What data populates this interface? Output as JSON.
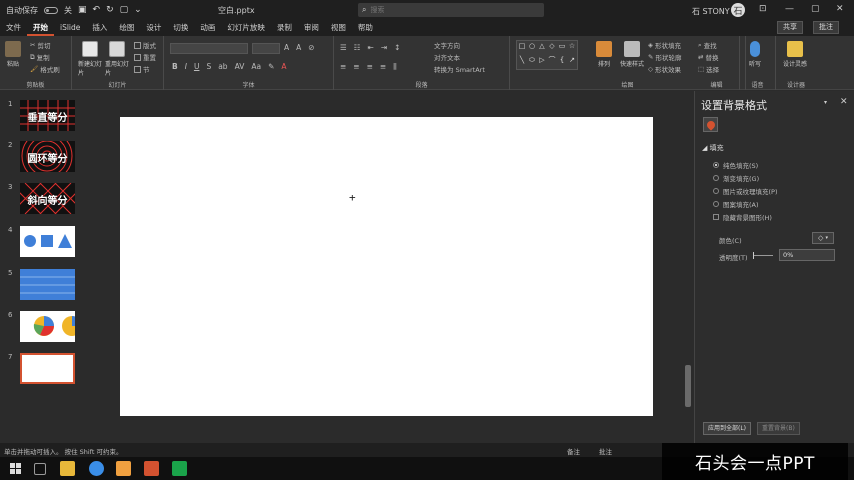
{
  "window": {
    "autosave_label": "自动保存",
    "autosave_state": "关",
    "doc_title": "空白.pptx",
    "search_placeholder": "搜索",
    "user_name": "石 STONY",
    "avatar_letter": "石",
    "ribbon_display_icon": "⊡",
    "minimize": "—",
    "maximize": "▢",
    "close": "✕"
  },
  "tabs": [
    "文件",
    "开始",
    "iSlide",
    "插入",
    "绘图",
    "设计",
    "切换",
    "动画",
    "幻灯片放映",
    "录制",
    "审阅",
    "视图",
    "帮助"
  ],
  "active_tab": "开始",
  "share_label": "共享",
  "comment_label": "批注",
  "ribbon": {
    "groups": {
      "clipboard": "剪贴板",
      "slides": "幻灯片",
      "font": "字体",
      "paragraph": "段落",
      "drawing": "绘图",
      "editing": "编辑",
      "voice": "语音",
      "designer": "设计器"
    },
    "paste": "粘贴",
    "cut": "剪切",
    "copy": "复制",
    "format_painter": "格式刷",
    "new_slide": "新建幻灯片",
    "reuse_slides": "重用幻灯片",
    "layout": "版式",
    "reset": "重置",
    "section": "节",
    "text_direction": "文字方向",
    "align_text": "对齐文本",
    "smartart": "转换为 SmartArt",
    "arrange": "排列",
    "quick_styles": "快速样式",
    "shape_fill": "形状填充",
    "shape_outline": "形状轮廓",
    "shape_effects": "形状效果",
    "find": "查找",
    "replace": "替换",
    "select": "选择",
    "dictate": "听写",
    "design_ideas": "设计灵感",
    "shapes": [
      "□",
      "○",
      "△",
      "◇",
      "▭",
      "☆",
      "╲",
      "⬭",
      "▷",
      "⌒",
      "{",
      "↗"
    ]
  },
  "slides": [
    {
      "num": "1",
      "title": "垂直等分"
    },
    {
      "num": "2",
      "title": "圆环等分"
    },
    {
      "num": "3",
      "title": "斜向等分"
    },
    {
      "num": "4",
      "title": ""
    },
    {
      "num": "5",
      "title": ""
    },
    {
      "num": "6",
      "title": ""
    },
    {
      "num": "7",
      "title": ""
    }
  ],
  "pane": {
    "title": "设置背景格式",
    "options_icon": "▾",
    "close_icon": "✕",
    "fill_section": "◢ 填充",
    "fill_options": [
      "纯色填充(S)",
      "渐变填充(G)",
      "图片或纹理填充(P)",
      "图案填充(A)"
    ],
    "hide_graphics": "隐藏背景图形(H)",
    "color_label": "颜色(C)",
    "color_picker_glyph": "◇",
    "transparency_label": "透明度(T)",
    "transparency_value": "0%",
    "apply_all": "应用到全部(L)",
    "reset_bg": "重置背景(B)"
  },
  "canvas": {
    "cursor": "+"
  },
  "status": {
    "text": "单击并拖动可插入。 按住 Shift 可约束。",
    "notes": "备注",
    "comments": "批注"
  },
  "watermark": "石头会一点PPT",
  "colors": {
    "accent": "#d35230",
    "slide_bg": "#ffffff",
    "app_bg": "#2b2b2b"
  }
}
